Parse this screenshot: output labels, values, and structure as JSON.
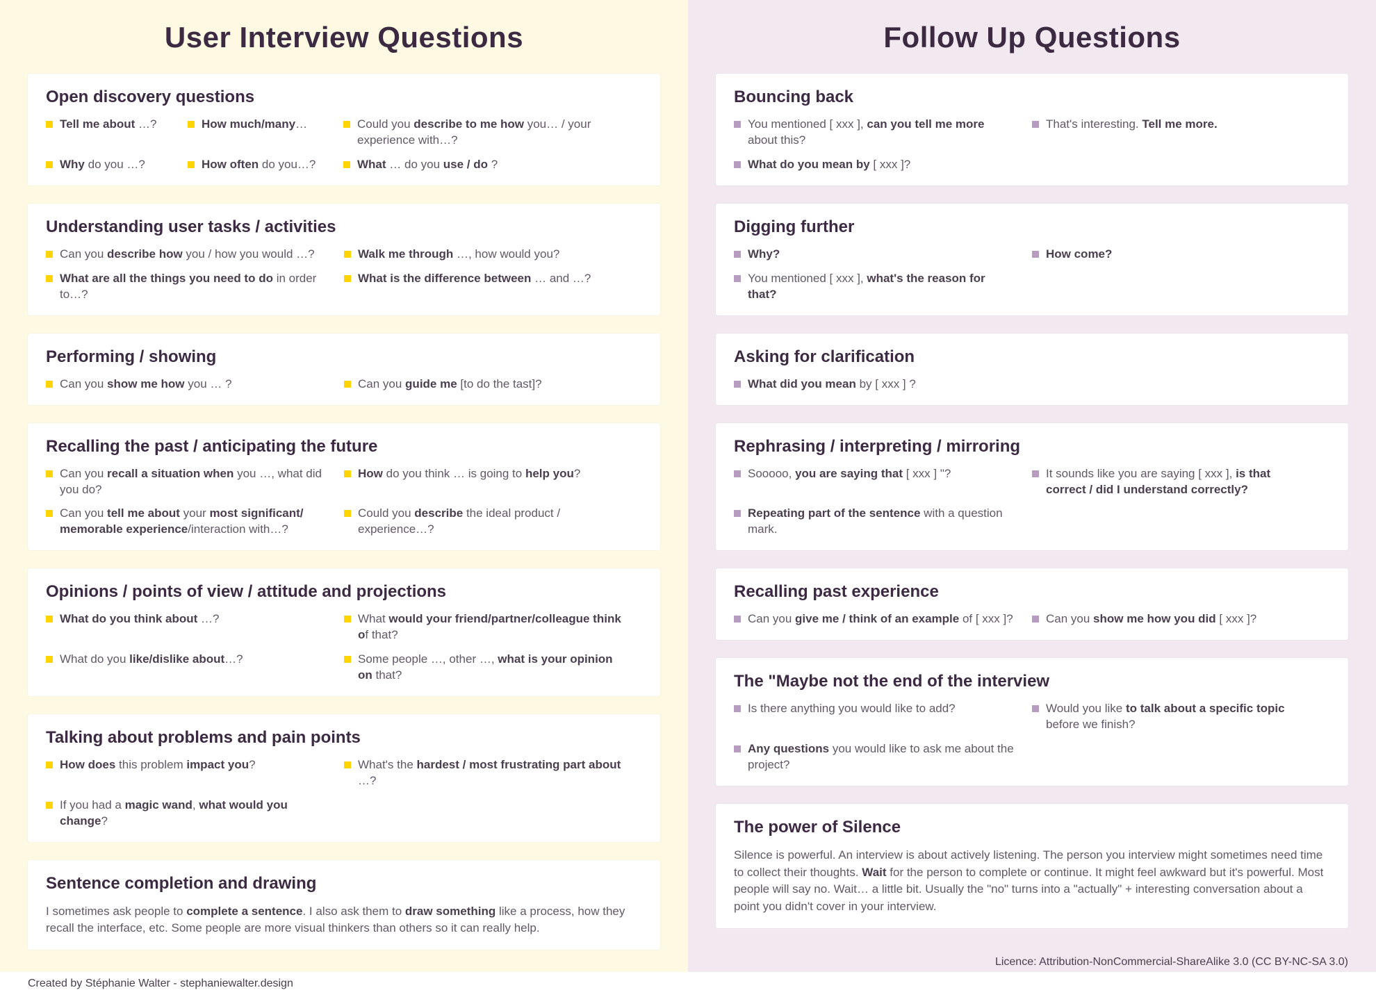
{
  "left": {
    "title": "User Interview Questions",
    "cards": [
      {
        "heading": "Open discovery questions",
        "items": [
          "<b>Tell me about</b> …?",
          "<b>How much/many</b>…",
          "Could you <b>describe to me how</b> you… / your experience with…?",
          "<b>Why</b> do you …?",
          "<b>How often</b> do you…?",
          "<b>What</b> … do you <b>use / do</b> ?"
        ],
        "ulClass": "open"
      },
      {
        "heading": "Understanding user tasks / activities",
        "items": [
          "Can you <b>describe how</b> you / how you would …?",
          "<b>Walk me through</b> …, how would you?",
          "<b>What are all the things you need to do</b> in order to…?",
          "<b>What is the difference between</b> … and …?"
        ],
        "ulClass": "cols-2"
      },
      {
        "heading": "Performing / showing",
        "items": [
          "Can you <b>show me how</b> you … ?",
          "Can you <b>guide me</b> [to do the tast]?"
        ],
        "ulClass": "cols-2"
      },
      {
        "heading": "Recalling the past / anticipating the future",
        "items": [
          "Can you <b>recall a situation when</b> you …, what did you do?",
          "<b>How</b> do you think … is going to <b>help you</b>?",
          "Can you <b>tell me about</b> your <b>most significant/ memorable experience</b>/interaction with…?",
          "Could you <b>describe</b> the ideal product / experience…?"
        ],
        "ulClass": "cols-2"
      },
      {
        "heading": "Opinions / points of view / attitude and projections",
        "items": [
          "<b>What do you think about</b> …?",
          "What <b>would your friend/partner/colleague think o</b>f that?",
          "What do you <b>like/dislike about</b>…?",
          "Some people …, other …, <b>what is your opinion on</b> that?"
        ],
        "ulClass": "cols-2"
      },
      {
        "heading": "Talking about problems and pain points",
        "items": [
          "<b>How does</b> this problem <b>impact you</b>?",
          "What's the <b>hardest / most frustrating part about</b> …?",
          "If you had a <b>magic wand</b>, <b>what would you change</b>?"
        ],
        "ulClass": "cols-2"
      },
      {
        "heading": "Sentence completion and drawing",
        "paragraph": "I sometimes ask people to <b>complete a sentence</b>. I also ask them to <b>draw something</b> like a process, how they recall the interface, etc. Some people are more visual thinkers than others so it can really help."
      }
    ],
    "footer": "Created by Stéphanie Walter - stephaniewalter.design"
  },
  "right": {
    "title": "Follow Up Questions",
    "cards": [
      {
        "heading": "Bouncing back",
        "items": [
          "You mentioned [ xxx ], <b>can you tell me more</b> about this?",
          "That's interesting. <b>Tell me more.</b>",
          "<b>What do you mean by</b> [ xxx ]?"
        ],
        "ulClass": "cols-2"
      },
      {
        "heading": "Digging further",
        "items": [
          "<b>Why?</b>",
          "<b>How come?</b>",
          "You mentioned [ xxx ], <b>what's the reason for that?</b>"
        ],
        "ulClass": "cols-2"
      },
      {
        "heading": "Asking for clarification",
        "items": [
          "<b>What did you mean</b> by [ xxx ] ?"
        ],
        "ulClass": "cols-1"
      },
      {
        "heading": "Rephrasing / interpreting / mirroring",
        "items": [
          "Sooooo, <b>you are saying that</b> [ xxx ] \"?",
          "It sounds like you are saying [ xxx ], <b>is that correct / did I understand correctly?</b>",
          "<b>Repeating part of the sentence</b> with a question mark."
        ],
        "ulClass": "cols-2"
      },
      {
        "heading": "Recalling past experience",
        "items": [
          "Can you <b>give me / think of an example</b> of [ xxx ]?",
          "Can you <b>show me how you did</b> [ xxx ]?"
        ],
        "ulClass": "cols-2"
      },
      {
        "heading": "The \"Maybe not the end of the interview",
        "items": [
          "Is there anything you would like to add?",
          "Would you like <b>to talk about a specific topic</b> before we finish?",
          "<b>Any questions</b> you would like to ask me about the project?"
        ],
        "ulClass": "cols-2"
      },
      {
        "heading": "The power of Silence",
        "paragraph": "Silence is powerful. An interview is about actively listening. The person you interview might sometimes need time to collect their thoughts. <b>Wait</b> for the person to complete or continue. It might feel awkward but it's powerful. Most people will say no. Wait… a little bit. Usually the \"no\" turns into a \"actually\" + interesting conversation about a point you didn't cover in your interview."
      }
    ],
    "footer": "Licence: Attribution-NonCommercial-ShareAlike 3.0 (CC BY-NC-SA 3.0)"
  }
}
